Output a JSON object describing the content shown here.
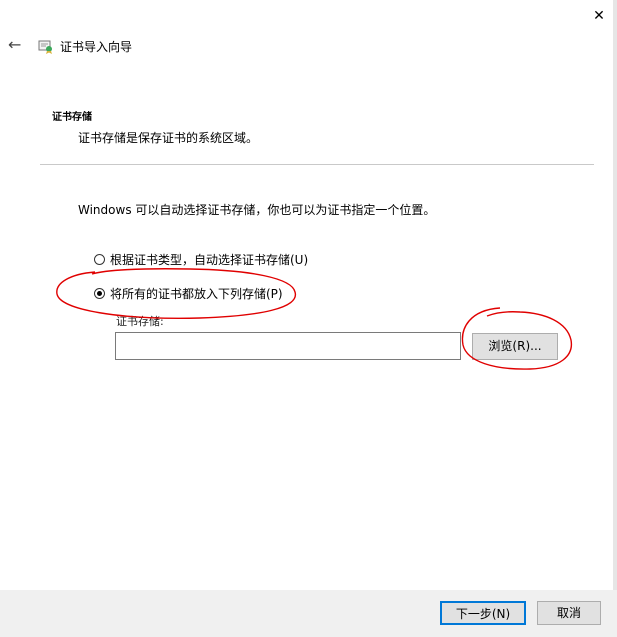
{
  "window": {
    "title": "证书导入向导",
    "close_glyph": "✕",
    "back_glyph": "←"
  },
  "section": {
    "title": "证书存储",
    "description": "证书存储是保存证书的系统区域。"
  },
  "intro": "Windows 可以自动选择证书存储，你也可以为证书指定一个位置。",
  "options": [
    {
      "label": "根据证书类型，自动选择证书存储(U)",
      "checked": false
    },
    {
      "label": "将所有的证书都放入下列存储(P)",
      "checked": true
    }
  ],
  "store": {
    "label": "证书存储:",
    "value": ""
  },
  "buttons": {
    "browse": "浏览(R)...",
    "next": "下一步(N)",
    "cancel": "取消"
  },
  "colors": {
    "annotation": "#e00000",
    "primary_border": "#0078d7"
  }
}
